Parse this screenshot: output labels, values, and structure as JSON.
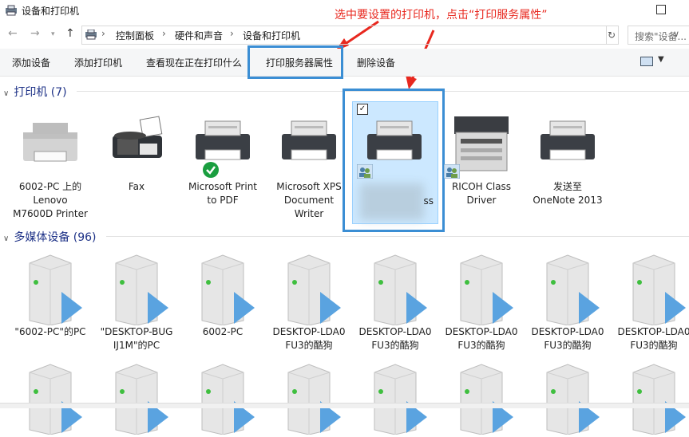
{
  "window": {
    "title": "设备和打印机"
  },
  "annotation": {
    "text": "选中要设置的打印机，点击“打印服务属性”"
  },
  "address": {
    "breadcrumbs": [
      "控制面板",
      "硬件和声音",
      "设备和打印机"
    ],
    "search_placeholder": "搜索\"设备..."
  },
  "toolbar": {
    "add_device": "添加设备",
    "add_printer": "添加打印机",
    "see_printing": "查看现在正在打印什么",
    "print_server_props": "打印服务器属性",
    "remove_device": "删除设备"
  },
  "groups": {
    "printers": {
      "title": "打印机 (7)"
    },
    "media": {
      "title": "多媒体设备 (96)"
    }
  },
  "printers": [
    {
      "icon": "printer-icon",
      "label": "6002-PC 上的\nLenovo\nM7600D Printer"
    },
    {
      "icon": "fax-icon",
      "label": "Fax"
    },
    {
      "icon": "printer-icon",
      "label": "Microsoft Print\nto PDF",
      "badge": "default-check-icon"
    },
    {
      "icon": "printer-icon",
      "label": "Microsoft XPS\nDocument\nWriter"
    },
    {
      "icon": "printer-icon",
      "label": "ss",
      "selected": true,
      "badge": "shared-users-icon"
    },
    {
      "icon": "mfp-printer-icon",
      "label": "RICOH Class\nDriver",
      "badge": "shared-users-icon"
    },
    {
      "icon": "printer-icon",
      "label": "发送至\nOneNote 2013"
    }
  ],
  "media": [
    {
      "label": "\"6002-PC\"的PC"
    },
    {
      "label": "\"DESKTOP-BUG\nIJ1M\"的PC"
    },
    {
      "label": "6002-PC"
    },
    {
      "label": "DESKTOP-LDA0\nFU3的酷狗"
    },
    {
      "label": "DESKTOP-LDA0\nFU3的酷狗"
    },
    {
      "label": "DESKTOP-LDA0\nFU3的酷狗"
    },
    {
      "label": "DESKTOP-LDA0\nFU3的酷狗"
    },
    {
      "label": "DESKTOP-LDA0\nFU3的酷狗"
    }
  ],
  "colors": {
    "annotation": "#e8281f",
    "highlight": "#3b8ed4",
    "group_header": "#1e3287",
    "selection": "#cce8ff"
  }
}
